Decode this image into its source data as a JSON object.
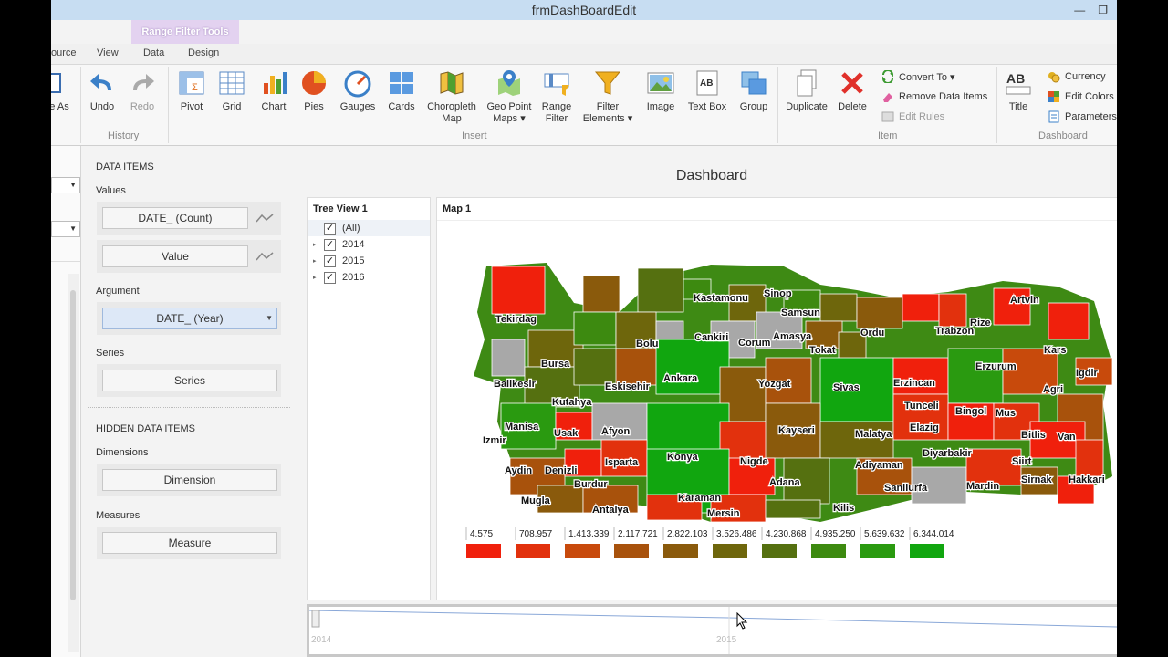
{
  "window": {
    "title": "frmDashBoardEdit"
  },
  "ribbon": {
    "context_tab": "Range Filter Tools",
    "tabs": [
      "ource",
      "View",
      "Data",
      "Design"
    ],
    "buttons": {
      "save_as": "e As",
      "undo": "Undo",
      "redo": "Redo",
      "pivot": "Pivot",
      "grid": "Grid",
      "chart": "Chart",
      "pies": "Pies",
      "gauges": "Gauges",
      "cards": "Cards",
      "choropleth_1": "Choropleth",
      "choropleth_2": "Map",
      "geopoint_1": "Geo Point",
      "geopoint_2": "Maps ▾",
      "range_1": "Range",
      "range_2": "Filter",
      "filter_el_1": "Filter",
      "filter_el_2": "Elements ▾",
      "image": "Image",
      "textbox": "Text Box",
      "group": "Group",
      "duplicate": "Duplicate",
      "delete": "Delete",
      "convert_to": "Convert To ▾",
      "remove_data_items": "Remove Data Items",
      "edit_rules": "Edit Rules",
      "title": "Title",
      "currency": "Currency",
      "edit_colors": "Edit Colors",
      "parameters": "Parameters"
    },
    "groups": {
      "history": "History",
      "insert": "Insert",
      "item": "Item",
      "dashboard": "Dashboard"
    }
  },
  "data_items": {
    "heading": "DATA ITEMS",
    "values_label": "Values",
    "values": [
      "DATE_ (Count)",
      "Value"
    ],
    "argument_label": "Argument",
    "argument": "DATE_ (Year)",
    "series_label": "Series",
    "series": "Series",
    "hidden_heading": "HIDDEN DATA ITEMS",
    "dimensions_label": "Dimensions",
    "dimension": "Dimension",
    "measures_label": "Measures",
    "measure": "Measure"
  },
  "dashboard": {
    "title": "Dashboard",
    "tree_view": {
      "title": "Tree View 1",
      "items": [
        {
          "label": "(All)",
          "checked": true,
          "expandable": false
        },
        {
          "label": "2014",
          "checked": true,
          "expandable": true
        },
        {
          "label": "2015",
          "checked": true,
          "expandable": true
        },
        {
          "label": "2016",
          "checked": true,
          "expandable": true
        }
      ]
    },
    "map": {
      "title": "Map 1",
      "labels": [
        "Tekirdag",
        "Kastamonu",
        "Sinop",
        "Samsun",
        "Artvin",
        "Rize",
        "Trabzon",
        "Ordu",
        "Kars",
        "Igdir",
        "Bolu",
        "Cankiri",
        "Corum",
        "Amasya",
        "Tokat",
        "Bursa",
        "Balikesir",
        "Eskisehir",
        "Ankara",
        "Yozgat",
        "Sivas",
        "Erzincan",
        "Erzurum",
        "Agri",
        "Tunceli",
        "Kutahya",
        "Manisa",
        "Izmir",
        "Usak",
        "Afyon",
        "Kayseri",
        "Malatya",
        "Elazig",
        "Bingol",
        "Mus",
        "Bitlis",
        "Van",
        "Aydin",
        "Denizli",
        "Isparta",
        "Konya",
        "Nigde",
        "Adiyaman",
        "Diyarbakir",
        "Siirt",
        "Sirnak",
        "Hakkari",
        "Mugla",
        "Burdur",
        "Antalya",
        "Karaman",
        "Mersin",
        "Adana",
        "Kilis",
        "Sanliurfa",
        "Mardin"
      ],
      "legend": [
        "4.575",
        "708.957",
        "1.413.339",
        "2.117.721",
        "2.822.103",
        "3.526.486",
        "4.230.868",
        "4.935.250",
        "5.639.632",
        "6.344.014"
      ],
      "legend_colors": [
        "#f0200c",
        "#e2310d",
        "#c84a0c",
        "#a8520c",
        "#8a5a0c",
        "#6e660c",
        "#557010",
        "#3d8a10",
        "#2a9a10",
        "#11a60f"
      ]
    },
    "range_filter": {
      "labels": [
        "2014",
        "2015"
      ]
    }
  }
}
